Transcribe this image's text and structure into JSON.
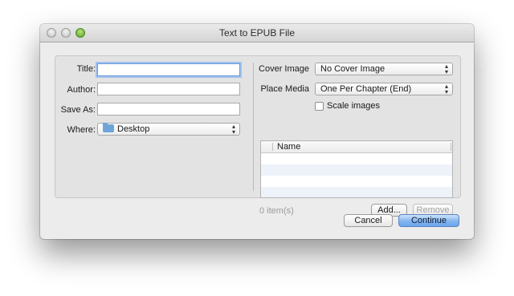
{
  "window": {
    "title": "Text to EPUB File"
  },
  "form": {
    "title_label": "Title:",
    "title_value": "",
    "author_label": "Author:",
    "author_value": "",
    "saveas_label": "Save As:",
    "saveas_value": "",
    "where_label": "Where:",
    "where_value": "Desktop"
  },
  "media": {
    "cover_label": "Cover Image",
    "cover_value": "No Cover Image",
    "place_label": "Place Media",
    "place_value": "One Per Chapter (End)",
    "scale_label": "Scale images",
    "scale_checked": false,
    "table_header": "Name",
    "item_count": "0 item(s)",
    "add_label": "Add...",
    "remove_label": "Remove"
  },
  "footer": {
    "cancel_label": "Cancel",
    "continue_label": "Continue"
  }
}
